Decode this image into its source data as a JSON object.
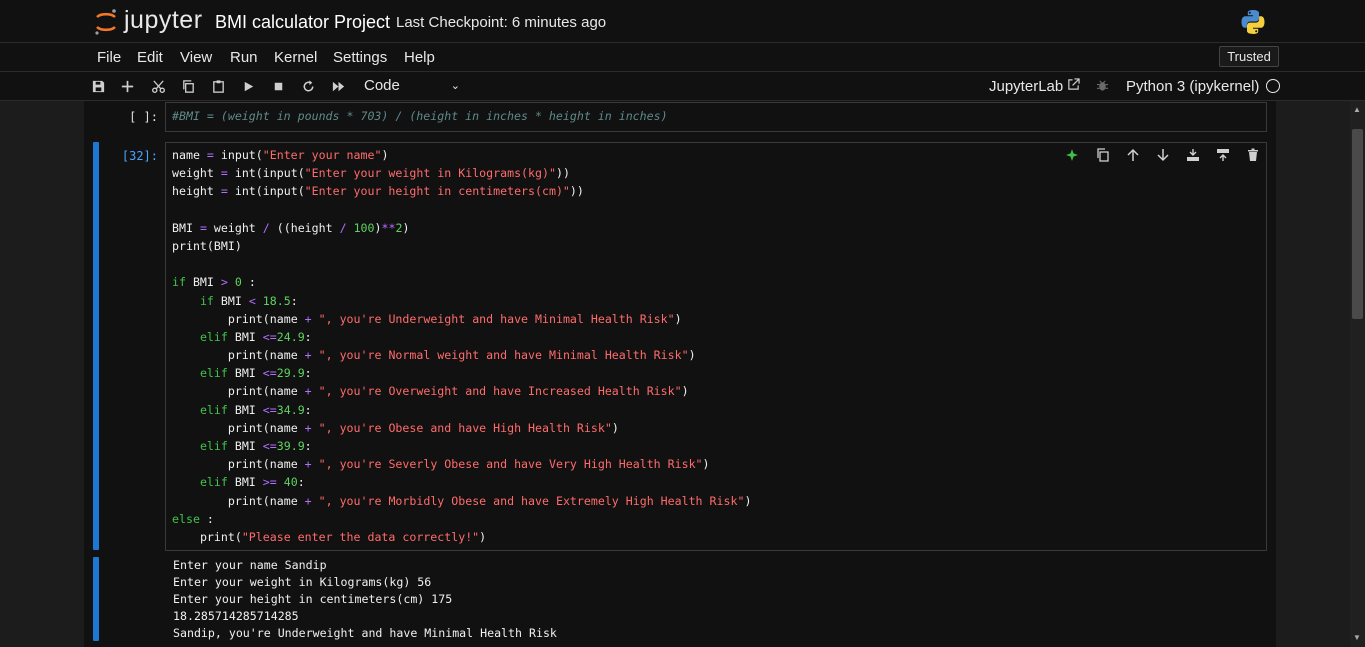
{
  "header": {
    "logo_text": "jupyter",
    "notebook_title": "BMI calculator Project",
    "checkpoint": "Last Checkpoint: 6 minutes ago"
  },
  "menu": {
    "items": [
      "File",
      "Edit",
      "View",
      "Run",
      "Kernel",
      "Settings",
      "Help"
    ],
    "trusted": "Trusted"
  },
  "toolbar": {
    "icons": [
      "save-icon",
      "add-cell-icon",
      "cut-icon",
      "copy-icon",
      "paste-icon",
      "run-icon",
      "stop-icon",
      "restart-icon",
      "fast-forward-icon"
    ],
    "cell_type": "Code",
    "jupyterlab_label": "JupyterLab",
    "kernel_name": "Python 3 (ipykernel)"
  },
  "cells": [
    {
      "prompt": "[ ]:",
      "source": "#BMI = (weight in pounds * 703) / (height in inches * height in inches)"
    },
    {
      "prompt": "[32]:",
      "lines": [
        "name = input(\"Enter your name\")",
        "weight = int(input(\"Enter your weight in Kilograms(kg)\"))",
        "height = int(input(\"Enter your height in centimeters(cm)\"))",
        "",
        "BMI = weight / ((height / 100)**2)",
        "print(BMI)",
        "",
        "if BMI > 0 :",
        "    if BMI < 18.5:",
        "        print(name + \", you're Underweight and have Minimal Health Risk\")",
        "    elif BMI <=24.9:",
        "        print(name + \", you're Normal weight and have Minimal Health Risk\")",
        "    elif BMI <=29.9:",
        "        print(name + \", you're Overweight and have Increased Health Risk\")",
        "    elif BMI <=34.9:",
        "        print(name + \", you're Obese and have High Health Risk\")",
        "    elif BMI <=39.9:",
        "        print(name + \", you're Severly Obese and have Very High Health Risk\")",
        "    elif BMI >= 40:",
        "        print(name + \", you're Morbidly Obese and have Extremely High Health Risk\")",
        "else :",
        "    print(\"Please enter the data correctly!\")"
      ],
      "tool_icons": [
        "sparkle-icon",
        "duplicate-icon",
        "move-up-icon",
        "move-down-icon",
        "insert-above-icon",
        "insert-below-icon",
        "delete-icon"
      ],
      "output": [
        "Enter your name Sandip",
        "Enter your weight in Kilograms(kg) 56",
        "Enter your height in centimeters(cm) 175",
        "18.285714285714285",
        "Sandip, you're Underweight and have Minimal Health Risk"
      ]
    }
  ],
  "colors": {
    "background": "#111111",
    "accent": "#1f77d4",
    "keyword": "#3ec44a",
    "string": "#ff6b6b",
    "operator": "#b36eff"
  }
}
